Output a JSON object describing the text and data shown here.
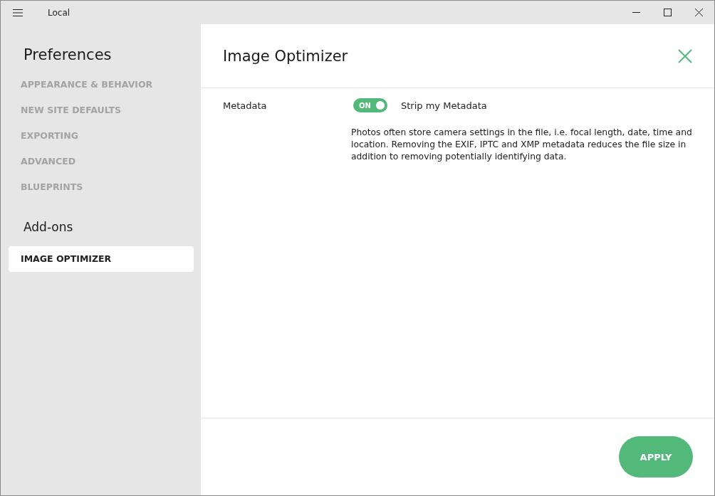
{
  "window": {
    "title": "Local"
  },
  "sidebar": {
    "sections": [
      {
        "heading": "Preferences",
        "items": [
          {
            "label": "APPEARANCE & BEHAVIOR",
            "selected": false
          },
          {
            "label": "NEW SITE DEFAULTS",
            "selected": false
          },
          {
            "label": "EXPORTING",
            "selected": false
          },
          {
            "label": "ADVANCED",
            "selected": false
          },
          {
            "label": "BLUEPRINTS",
            "selected": false
          }
        ]
      },
      {
        "heading": "Add-ons",
        "items": [
          {
            "label": "IMAGE OPTIMIZER",
            "selected": true
          }
        ]
      }
    ]
  },
  "panel": {
    "title": "Image Optimizer",
    "settings": [
      {
        "label": "Metadata",
        "toggle": {
          "on": true,
          "text": "ON"
        },
        "option": "Strip my Metadata",
        "description": "Photos often store camera settings in the file, i.e. focal length, date, time and location. Removing the EXIF, IPTC and XMP metadata reduces the file size in addition to removing potentially identifying data."
      }
    ],
    "button": "APPLY"
  }
}
